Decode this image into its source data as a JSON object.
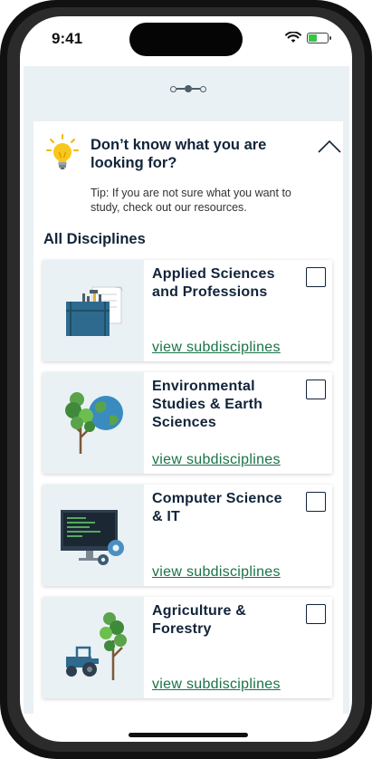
{
  "status_bar": {
    "time": "9:41"
  },
  "hint": {
    "title": "Don’t know what you are looking for?",
    "tip": "Tip: If you are not sure what you want to study, check out our resources."
  },
  "section": {
    "title": "All Disciplines"
  },
  "disciplines": [
    {
      "title": "Applied Sciences and Professions",
      "link": "view subdisciplines",
      "checked": false,
      "illustration": "toolbox-illustration"
    },
    {
      "title": "Environmental Studies & Earth Sciences",
      "link": "view subdisciplines",
      "checked": false,
      "illustration": "globe-tree-illustration"
    },
    {
      "title": "Computer Science & IT",
      "link": "view subdisciplines",
      "checked": false,
      "illustration": "computer-gear-illustration"
    },
    {
      "title": "Agriculture & Forestry",
      "link": "view subdisciplines",
      "checked": false,
      "illustration": "tractor-tree-illustration"
    }
  ],
  "colors": {
    "accent_green": "#1a7346",
    "text_dark": "#11243a",
    "background": "#eaf1f4"
  }
}
